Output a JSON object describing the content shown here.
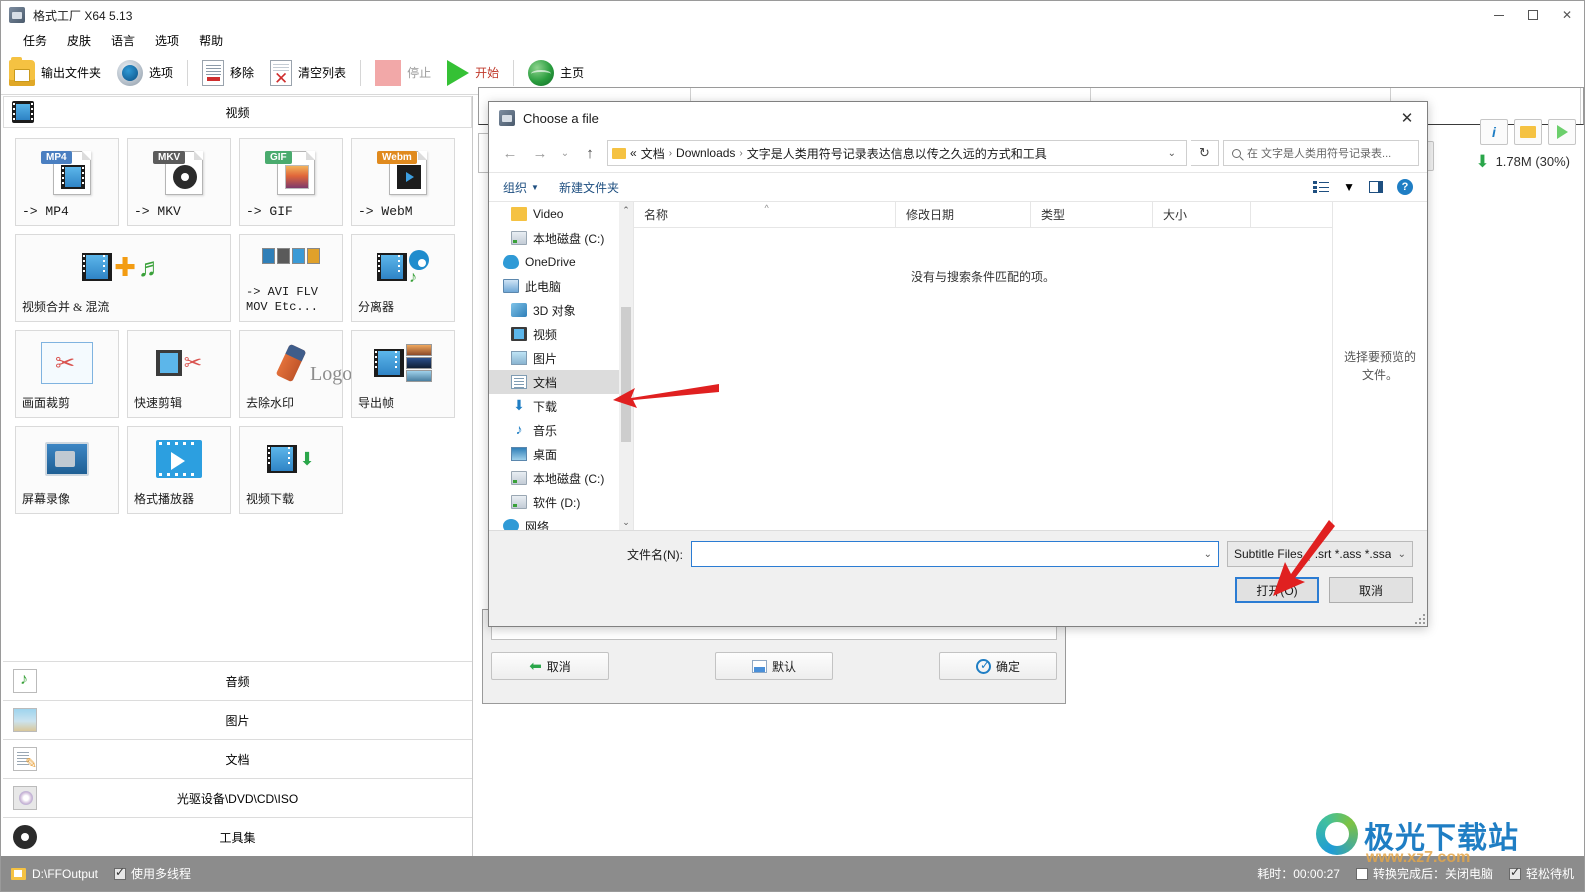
{
  "window": {
    "title": "格式工厂 X64 5.13",
    "app_icon": "app-icon",
    "minimize": "—",
    "maximize": "□",
    "close": "✕"
  },
  "menubar": {
    "items": [
      {
        "label": "任务"
      },
      {
        "label": "皮肤"
      },
      {
        "label": "语言"
      },
      {
        "label": "选项"
      },
      {
        "label": "帮助"
      }
    ]
  },
  "toolbar": {
    "items": [
      {
        "label": "输出文件夹",
        "icon": "output-folder-icon"
      },
      {
        "label": "选项",
        "icon": "options-gear-icon"
      },
      {
        "label": "移除",
        "icon": "remove-doc-icon"
      },
      {
        "label": "清空列表",
        "icon": "clear-list-icon"
      },
      {
        "label": "停止",
        "icon": "stop-icon"
      },
      {
        "label": "开始",
        "icon": "start-play-icon"
      },
      {
        "label": "主页",
        "icon": "home-globe-icon"
      }
    ]
  },
  "left_panel": {
    "category_header": {
      "title": "视频",
      "icon": "film-icon"
    },
    "tiles": [
      {
        "label": "-> MP4",
        "tag": "MP4",
        "icon": "mp4-file-icon"
      },
      {
        "label": "-> MKV",
        "tag": "MKV",
        "icon": "mkv-file-icon"
      },
      {
        "label": "-> GIF",
        "tag": "GIF",
        "icon": "gif-file-icon"
      },
      {
        "label": "-> WebM",
        "tag": "Webm",
        "icon": "webm-file-icon"
      },
      {
        "label": "视频合并 & 混流",
        "icon": "merge-mux-icon"
      },
      {
        "label": "-> AVI FLV\nMOV Etc...",
        "label1": "-> AVI FLV",
        "label2": "MOV Etc...",
        "icon": "avi-flv-mov-icon"
      },
      {
        "label": "分离器",
        "icon": "demuxer-icon"
      },
      {
        "label": "画面裁剪",
        "icon": "crop-icon"
      },
      {
        "label": "快速剪辑",
        "icon": "quick-edit-icon"
      },
      {
        "label": "去除水印",
        "icon": "remove-watermark-icon",
        "logo_text": "Logo"
      },
      {
        "label": "导出帧",
        "icon": "export-frames-icon"
      },
      {
        "label": "屏幕录像",
        "icon": "screen-record-icon"
      },
      {
        "label": "格式播放器",
        "icon": "format-player-icon"
      },
      {
        "label": "视频下载",
        "icon": "video-download-icon"
      }
    ],
    "categories": [
      {
        "label": "音频",
        "icon": "audio-icon"
      },
      {
        "label": "图片",
        "icon": "picture-icon"
      },
      {
        "label": "文档",
        "icon": "document-icon"
      },
      {
        "label": "光驱设备\\DVD\\CD\\ISO",
        "icon": "disc-icon"
      },
      {
        "label": "工具集",
        "icon": "toolset-icon"
      }
    ]
  },
  "task_list": {
    "columns": [
      "",
      "",
      "",
      ""
    ]
  },
  "right_tools": {
    "info_label": "i",
    "folder_label": "",
    "play_label": "",
    "progress_text": "1.78M  (30%)",
    "download_arrow": "⬇"
  },
  "option_dialog": {
    "cancel": "取消",
    "default": "默认",
    "confirm": "确定"
  },
  "file_dialog": {
    "title": "Choose a file",
    "close": "✕",
    "nav": {
      "back": "←",
      "forward": "→",
      "recent": "⌄",
      "up": "↑"
    },
    "breadcrumb": {
      "prefix": "«",
      "segments": [
        "文档",
        "Downloads",
        "文字是人类用符号记录表达信息以传之久远的方式和工具"
      ],
      "separator": "›",
      "dropdown": "⌄"
    },
    "refresh": "↻",
    "search": {
      "placeholder": "在 文字是人类用符号记录表...",
      "icon": "search-icon"
    },
    "commandbar": {
      "organize": "组织",
      "organize_caret": "▼",
      "new_folder": "新建文件夹",
      "view_icon": "view-list-icon",
      "view_caret": "▼",
      "pane_icon": "preview-pane-icon",
      "help_icon": "?"
    },
    "tree": [
      {
        "label": "Video",
        "icon": "folder-icon",
        "level": 2,
        "selected": false
      },
      {
        "label": "本地磁盘 (C:)",
        "icon": "drive-icon",
        "level": 2,
        "selected": false
      },
      {
        "label": "OneDrive",
        "icon": "onedrive-icon",
        "level": 1,
        "selected": false
      },
      {
        "label": "此电脑",
        "icon": "this-pc-icon",
        "level": 1,
        "selected": false
      },
      {
        "label": "3D 对象",
        "icon": "3d-objects-icon",
        "level": 2,
        "selected": false
      },
      {
        "label": "视频",
        "icon": "videos-icon",
        "level": 2,
        "selected": false
      },
      {
        "label": "图片",
        "icon": "pictures-icon",
        "level": 2,
        "selected": false
      },
      {
        "label": "文档",
        "icon": "documents-icon",
        "level": 2,
        "selected": true
      },
      {
        "label": "下载",
        "icon": "downloads-icon",
        "level": 2,
        "selected": false
      },
      {
        "label": "音乐",
        "icon": "music-icon",
        "level": 2,
        "selected": false
      },
      {
        "label": "桌面",
        "icon": "desktop-icon",
        "level": 2,
        "selected": false
      },
      {
        "label": "本地磁盘 (C:)",
        "icon": "drive-icon",
        "level": 2,
        "selected": false
      },
      {
        "label": "软件 (D:)",
        "icon": "drive-icon",
        "level": 2,
        "selected": false
      },
      {
        "label": "网络",
        "icon": "network-icon",
        "level": 1,
        "selected": false
      }
    ],
    "list": {
      "columns": [
        "名称",
        "修改日期",
        "类型",
        "大小"
      ],
      "sort_caret": "^",
      "empty_message": "没有与搜索条件匹配的项。",
      "rows": []
    },
    "preview": {
      "message": "选择要预览的文件。"
    },
    "filename": {
      "label": "文件名(N):",
      "value": "",
      "caret": "⌄"
    },
    "filetype": {
      "value": "Subtitle Files (*.srt *.ass *.ssa",
      "caret": "⌄"
    },
    "buttons": {
      "open": "打开(O)",
      "cancel": "取消"
    }
  },
  "statusbar": {
    "output_path": "D:\\FFOutput",
    "multithread_label": "使用多线程",
    "multithread_checked": true,
    "elapsed_label": "耗时：00:00:27",
    "after_convert_label": "转换完成后：关闭电脑",
    "after_convert_checked": false,
    "standby_label": "轻松待机",
    "standby_checked": true
  },
  "watermark": {
    "title": "极光下载站",
    "subtitle": "www.xz7.com"
  }
}
